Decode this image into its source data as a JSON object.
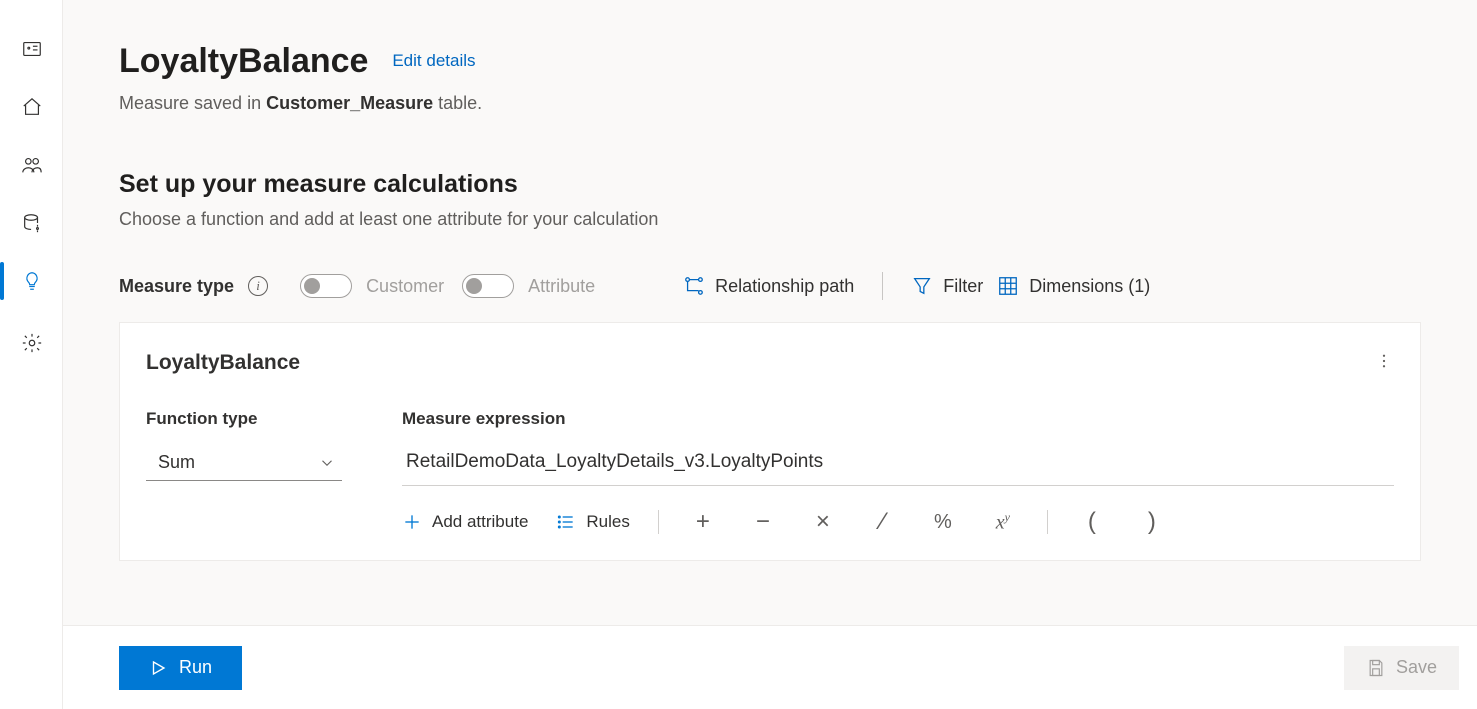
{
  "header": {
    "title": "LoyaltyBalance",
    "edit_link": "Edit details",
    "saved_prefix": "Measure saved in ",
    "saved_table": "Customer_Measure",
    "saved_suffix": " table."
  },
  "section": {
    "title": "Set up your measure calculations",
    "subtitle": "Choose a function and add at least one attribute for your calculation"
  },
  "controls": {
    "measure_type_label": "Measure type",
    "toggle_customer": "Customer",
    "toggle_attribute": "Attribute",
    "relationship_path": "Relationship path",
    "filter": "Filter",
    "dimensions": "Dimensions (1)"
  },
  "card": {
    "title": "LoyaltyBalance",
    "function_type_label": "Function type",
    "function_type_value": "Sum",
    "expression_label": "Measure expression",
    "expression_value": "RetailDemoData_LoyaltyDetails_v3.LoyaltyPoints",
    "add_attribute": "Add attribute",
    "rules": "Rules"
  },
  "footer": {
    "run": "Run",
    "save": "Save"
  }
}
